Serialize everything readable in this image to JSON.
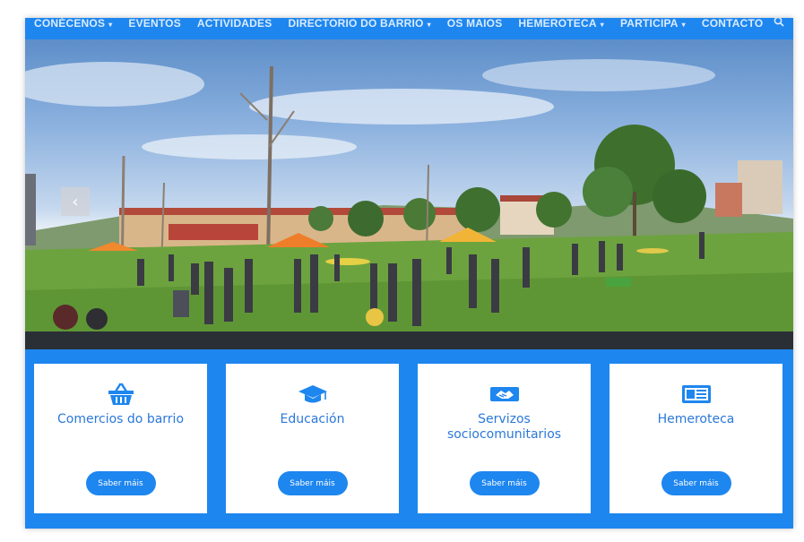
{
  "nav": {
    "items": [
      {
        "label": "CONÉCENOS",
        "caret": "▾"
      },
      {
        "label": "EVENTOS",
        "caret": ""
      },
      {
        "label": "ACTIVIDADES",
        "caret": ""
      },
      {
        "label": "DIRECTORIO DO BARRIO",
        "caret": "▾"
      },
      {
        "label": "OS MAIOS",
        "caret": ""
      },
      {
        "label": "HEMEROTECA",
        "caret": "▾"
      },
      {
        "label": "PARTICIPA",
        "caret": "▾"
      },
      {
        "label": "CONTACTO",
        "caret": ""
      }
    ],
    "search_icon": "search-icon"
  },
  "hero": {
    "prev_arrow": "‹"
  },
  "cards": [
    {
      "icon": "basket-icon",
      "title": "Comercios do barrio",
      "button": "Saber máis"
    },
    {
      "icon": "graduation-cap-icon",
      "title": "Educación",
      "button": "Saber máis"
    },
    {
      "icon": "handshake-icon",
      "title": "Servizos sociocomunitarios",
      "button": "Saber máis"
    },
    {
      "icon": "newspaper-icon",
      "title": "Hemeroteca",
      "button": "Saber máis"
    }
  ],
  "colors": {
    "accent": "#1e86ef",
    "card_text": "#2b78d8",
    "dark_bar": "#2a2f36"
  }
}
